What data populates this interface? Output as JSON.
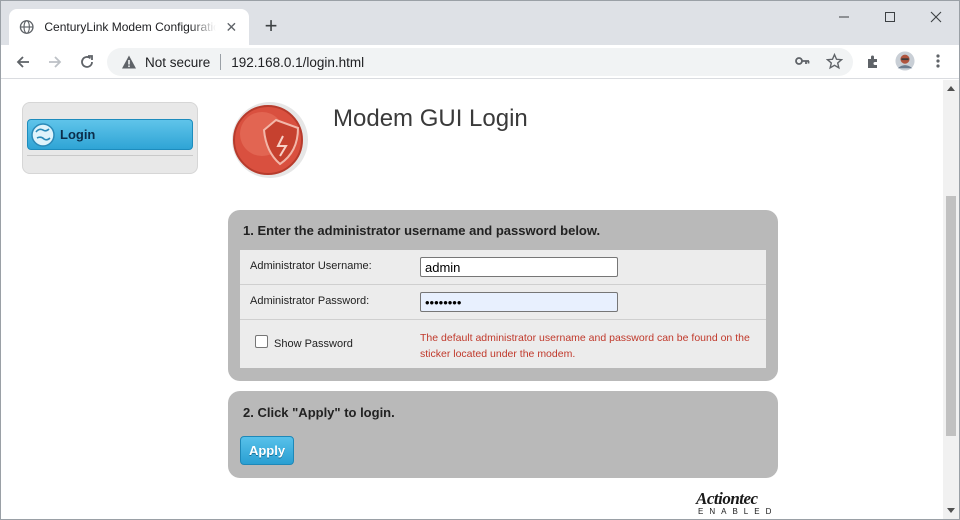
{
  "browser": {
    "tab_title": "CenturyLink Modem Configuration",
    "new_tab_label": "+",
    "not_secure_label": "Not secure",
    "url": "192.168.0.1/login.html",
    "icons": [
      "globe-icon",
      "close-icon",
      "plus-icon",
      "minimize-icon",
      "maximize-icon",
      "close-window-icon",
      "back-icon",
      "forward-icon",
      "reload-icon",
      "warning-icon",
      "key-icon",
      "star-icon",
      "extensions-icon",
      "avatar",
      "kebab-menu-icon"
    ]
  },
  "sidebar": {
    "items": [
      {
        "label": "Login",
        "icon": "globe-icon"
      }
    ]
  },
  "page": {
    "title": "Modem GUI Login"
  },
  "step1": {
    "heading": "1. Enter the administrator username and password below.",
    "username_label": "Administrator Username:",
    "username_value": "admin",
    "password_label": "Administrator Password:",
    "password_value": "••••••••",
    "show_password_label": "Show Password",
    "show_password_checked": false,
    "note": "The default administrator username and password can be found on the sticker located under the modem."
  },
  "step2": {
    "heading": "2. Click \"Apply\" to login.",
    "apply_label": "Apply"
  },
  "brand": {
    "name": "Actiontec",
    "tagline": "ENABLED"
  },
  "colors": {
    "accent_blue": "#2fa4d5",
    "panel_gray": "#b9b9b9",
    "note_red": "#c0392b",
    "logo_red": "#d9503f"
  }
}
